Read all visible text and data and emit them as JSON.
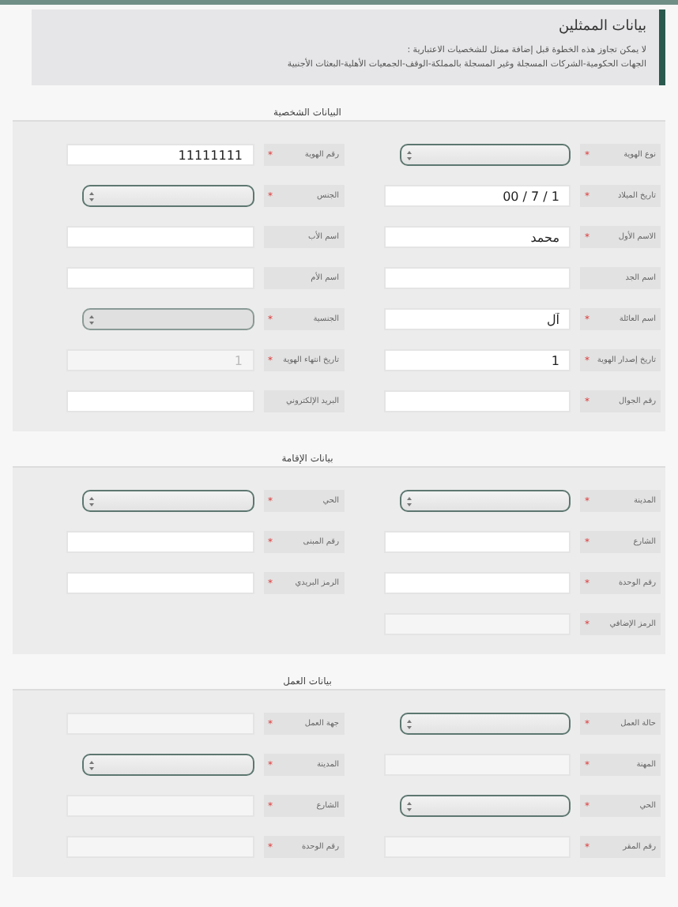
{
  "header": {
    "title": "بيانات الممثلين",
    "notes": [
      "لا يمكن تجاوز هذه الخطوة قبل إضافة ممثل للشخصيات الاعتبارية :",
      "الجهات الحكومية-الشركات المسجلة وغير المسجلة بالمملكة-الوقف-الجمعيات الأهلية-البعثات الأجنبية"
    ]
  },
  "sections": [
    {
      "title": "البيانات الشخصية",
      "fields": [
        {
          "label": "نوع الهوية",
          "mark": "*",
          "kind": "select"
        },
        {
          "label": "رقم الهوية",
          "mark": "*",
          "kind": "text",
          "value": "11111111"
        },
        {
          "label": "تاريخ الميلاد",
          "mark": "*",
          "kind": "text",
          "value": "00 / 7 / 1"
        },
        {
          "label": "الجنس",
          "mark": "*",
          "kind": "select"
        },
        {
          "label": "الاسم الأول",
          "mark": "*",
          "kind": "text",
          "value": "محمد"
        },
        {
          "label": "اسم الأب",
          "kind": "text"
        },
        {
          "label": "اسم الجد",
          "kind": "text"
        },
        {
          "label": "اسم الأم",
          "kind": "text"
        },
        {
          "label": "اسم العائلة",
          "mark": "*",
          "kind": "text",
          "value": "آل"
        },
        {
          "label": "الجنسية",
          "mark": "*",
          "kind": "select",
          "disabled": true
        },
        {
          "label": "تاريخ إصدار الهوية",
          "mark": "*",
          "kind": "text",
          "value": "1"
        },
        {
          "label": "تاريخ انتهاء الهوية",
          "mark": "*",
          "kind": "text",
          "value": "1",
          "disabled": true
        },
        {
          "label": "رقم الجوال",
          "mark": "*",
          "kind": "text"
        },
        {
          "label": "البريد الإلكتروني",
          "kind": "text"
        }
      ]
    },
    {
      "title": "بيانات الإقامة",
      "fields": [
        {
          "label": "المدينة",
          "mark": "*",
          "kind": "select"
        },
        {
          "label": "الحي",
          "mark": "*",
          "kind": "select"
        },
        {
          "label": "الشارع",
          "mark": "*",
          "kind": "text"
        },
        {
          "label": "رقم المبنى",
          "mark": "*",
          "kind": "text"
        },
        {
          "label": "رقم الوحدة",
          "mark": "*",
          "kind": "text"
        },
        {
          "label": "الرمز البريدي",
          "mark": "*",
          "kind": "text"
        },
        {
          "label": "الرمز الإضافي",
          "mark": "*",
          "kind": "text",
          "disabled": true
        }
      ]
    },
    {
      "title": "بيانات العمل",
      "fields": [
        {
          "label": "حالة العمل",
          "mark": "*",
          "kind": "select"
        },
        {
          "label": "جهة العمل",
          "mark": "*",
          "kind": "text",
          "disabled": true
        },
        {
          "label": "المهنة",
          "mark": "*",
          "kind": "text",
          "disabled": true
        },
        {
          "label": "المدينة",
          "mark": "*",
          "kind": "select"
        },
        {
          "label": "الحي",
          "mark": "*",
          "kind": "select"
        },
        {
          "label": "الشارع",
          "mark": "*",
          "kind": "text",
          "disabled": true
        },
        {
          "label": "رقم المقر",
          "mark": "*",
          "kind": "text",
          "disabled": true
        },
        {
          "label": "رقم الوحدة",
          "mark": "*",
          "kind": "text",
          "disabled": true
        }
      ]
    }
  ]
}
